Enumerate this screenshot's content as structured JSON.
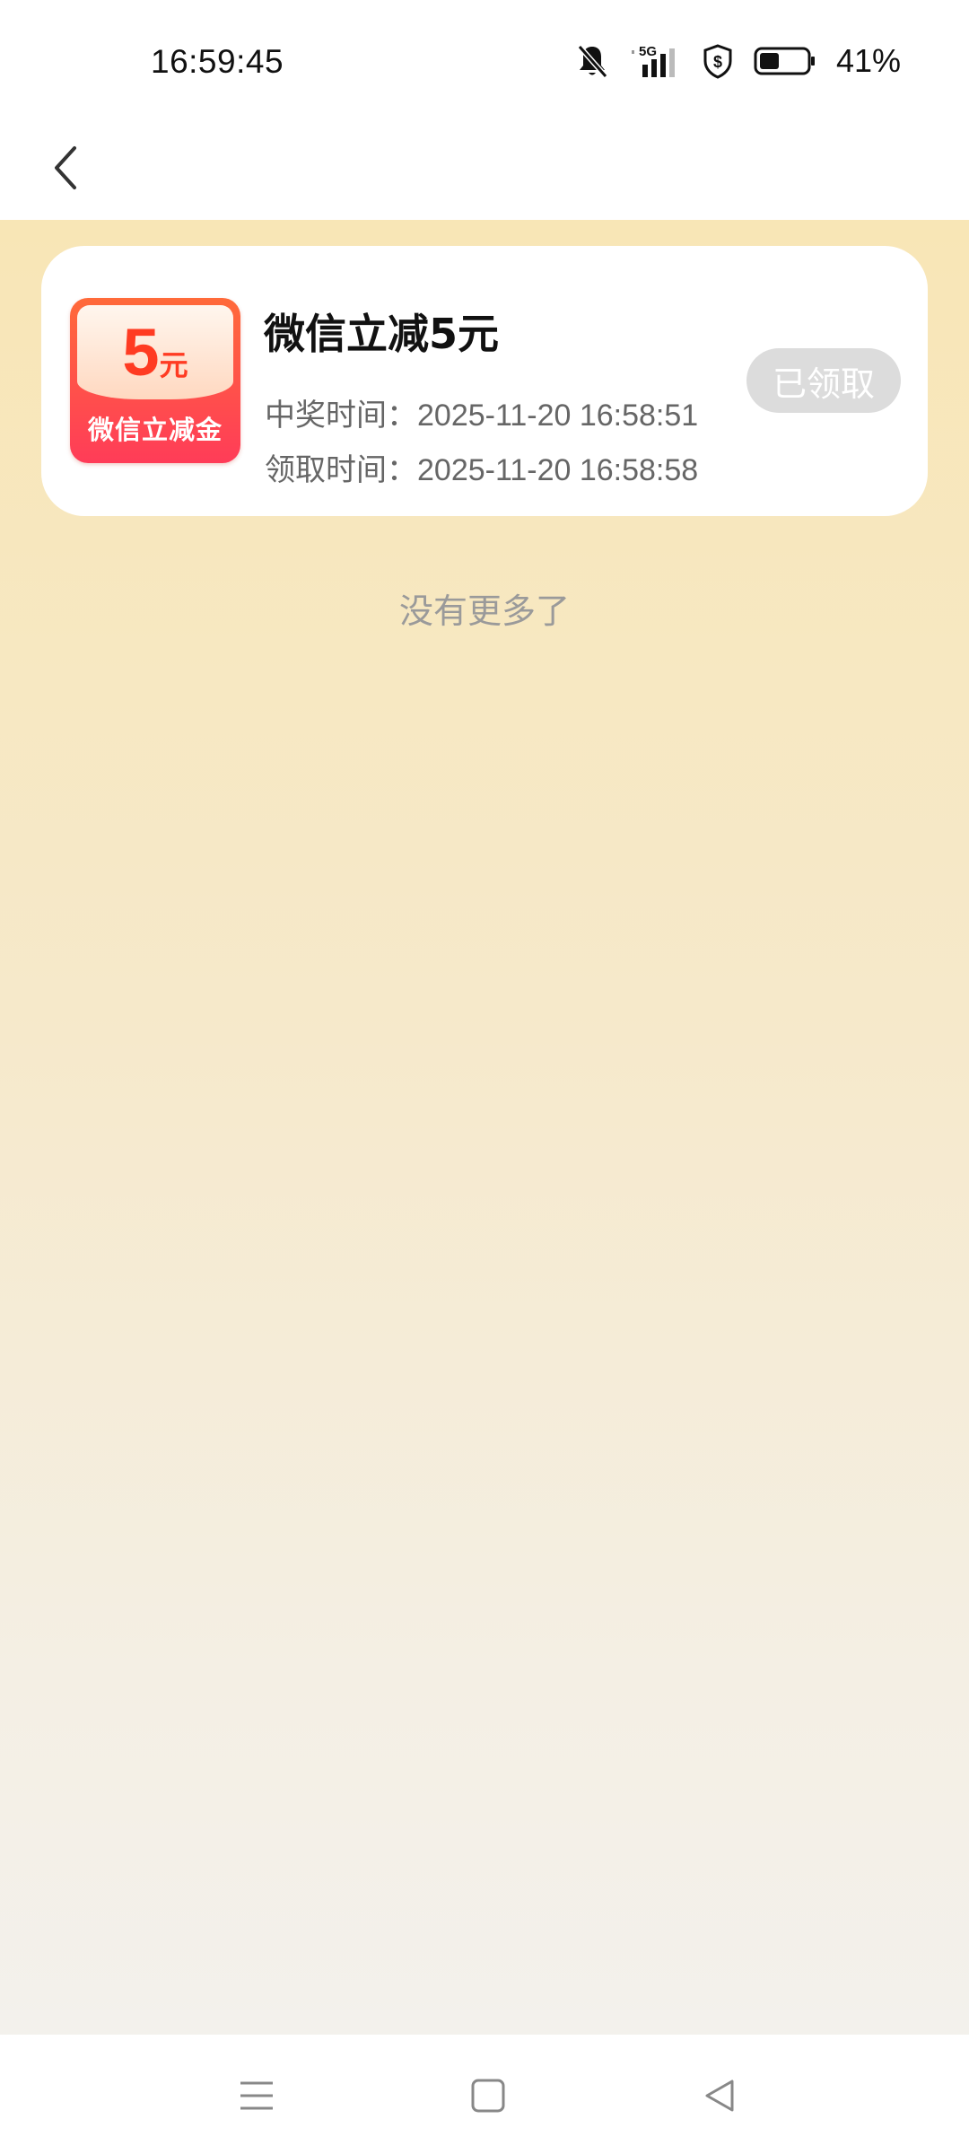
{
  "status_bar": {
    "time": "16:59:45",
    "network": "5G",
    "battery_percent": "41%",
    "battery_level": 0.41,
    "icons": [
      "bell-muted-icon",
      "signal-5g-icon",
      "shield-dollar-icon",
      "battery-icon"
    ]
  },
  "header": {
    "back_icon": "chevron-left-icon"
  },
  "prize": {
    "badge_amount": "5",
    "badge_unit": "元",
    "badge_label": "微信立减金",
    "title": "微信立减5元",
    "win_time_label": "中奖时间：",
    "win_time": "2025-11-20 16:58:51",
    "claim_time_label": "领取时间：",
    "claim_time": "2025-11-20 16:58:58",
    "status_button": "已领取"
  },
  "footer_text": "没有更多了",
  "nav": {
    "icons": [
      "menu-icon",
      "home-icon",
      "back-triangle-icon"
    ]
  },
  "colors": {
    "accent_red": "#ff3b22",
    "background_gradient_top": "#f8e6b6",
    "claimed_gray": "#dcdcdc"
  }
}
